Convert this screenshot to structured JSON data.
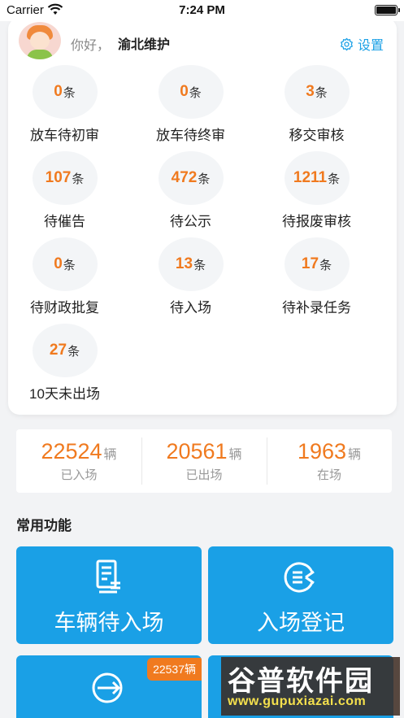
{
  "status_bar": {
    "carrier": "Carrier",
    "time": "7:24 PM"
  },
  "header": {
    "greeting": "你好，",
    "username": "渝北维护",
    "settings_label": "设置"
  },
  "stats": [
    {
      "value": "0",
      "unit": "条",
      "label": "放车待初审"
    },
    {
      "value": "0",
      "unit": "条",
      "label": "放车待终审"
    },
    {
      "value": "3",
      "unit": "条",
      "label": "移交审核"
    },
    {
      "value": "107",
      "unit": "条",
      "label": "待催告"
    },
    {
      "value": "472",
      "unit": "条",
      "label": "待公示"
    },
    {
      "value": "1211",
      "unit": "条",
      "label": "待报废审核"
    },
    {
      "value": "0",
      "unit": "条",
      "label": "待财政批复"
    },
    {
      "value": "13",
      "unit": "条",
      "label": "待入场"
    },
    {
      "value": "17",
      "unit": "条",
      "label": "待补录任务"
    },
    {
      "value": "27",
      "unit": "条",
      "label": "10天未出场"
    }
  ],
  "summary": [
    {
      "value": "22524",
      "unit": "辆",
      "label": "已入场"
    },
    {
      "value": "20561",
      "unit": "辆",
      "label": "已出场"
    },
    {
      "value": "1963",
      "unit": "辆",
      "label": "在场"
    }
  ],
  "section_title": "常用功能",
  "tiles": [
    {
      "label": "车辆待入场",
      "icon": "document-list-icon"
    },
    {
      "label": "入场登记",
      "icon": "register-circle-icon"
    },
    {
      "label": "",
      "icon": "exit-arrow-icon",
      "badge": "22537辆"
    },
    {
      "label": "",
      "icon": ""
    }
  ],
  "watermark": {
    "title": "谷普软件园",
    "url": "www.gupuxiazai.com"
  },
  "colors": {
    "accent": "#1aa0e6",
    "number": "#f07a1f",
    "background": "#f2f3f5"
  }
}
